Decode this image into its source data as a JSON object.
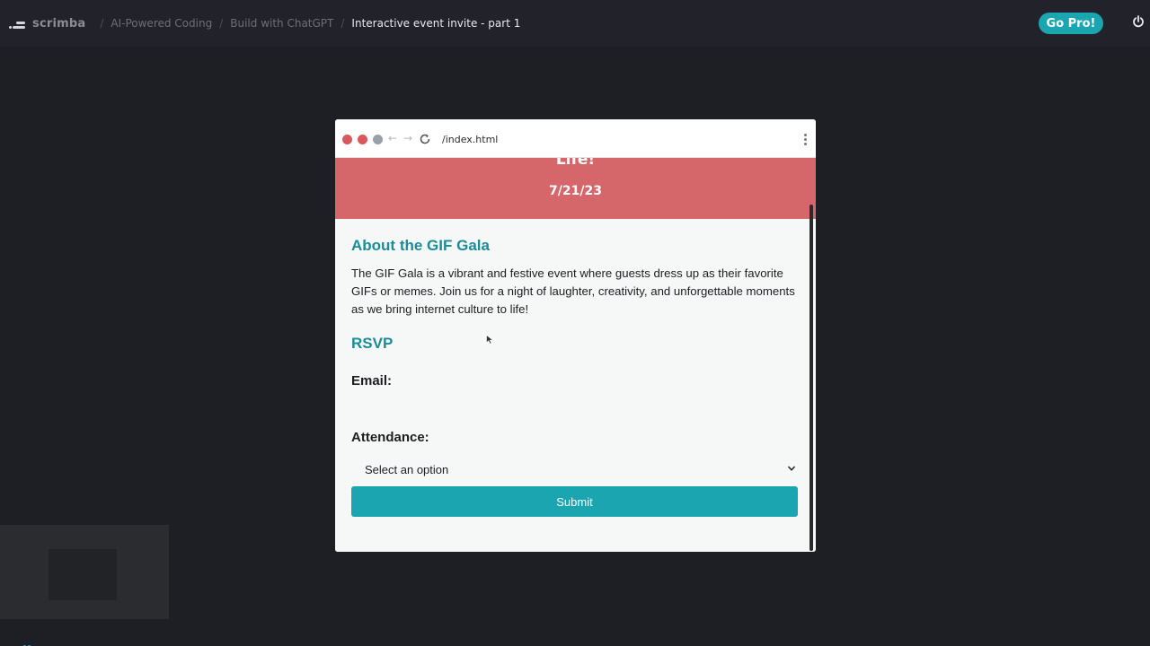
{
  "topbar": {
    "logo_text": "scrimba",
    "breadcrumbs": [
      "AI-Powered Coding",
      "Build with ChatGPT",
      "Interactive event invite - part 1"
    ],
    "go_pro_label": "Go Pro!"
  },
  "browser": {
    "url": "/index.html"
  },
  "page": {
    "hero_title": "Life!",
    "hero_date": "7/21/23",
    "about_heading": "About the GIF Gala",
    "about_text": "The GIF Gala is a vibrant and festive event where guests dress up as their favorite GIFs or memes. Join us for a night of laughter, creativity, and unforgettable moments as we bring internet culture to life!",
    "rsvp_heading": "RSVP",
    "email_label": "Email:",
    "attendance_label": "Attendance:",
    "attendance_selected": "Select an option",
    "submit_label": "Submit"
  },
  "colors": {
    "accent": "#1aa5b0",
    "hero": "#d5666a",
    "heading": "#1b8c98",
    "background": "#1e1f25"
  },
  "icons": [
    "scrimba-logo-icon",
    "power-icon",
    "reload-icon",
    "back-arrow-icon",
    "forward-arrow-icon",
    "kebab-menu-icon",
    "chevron-down-icon",
    "mouse-cursor-icon"
  ]
}
